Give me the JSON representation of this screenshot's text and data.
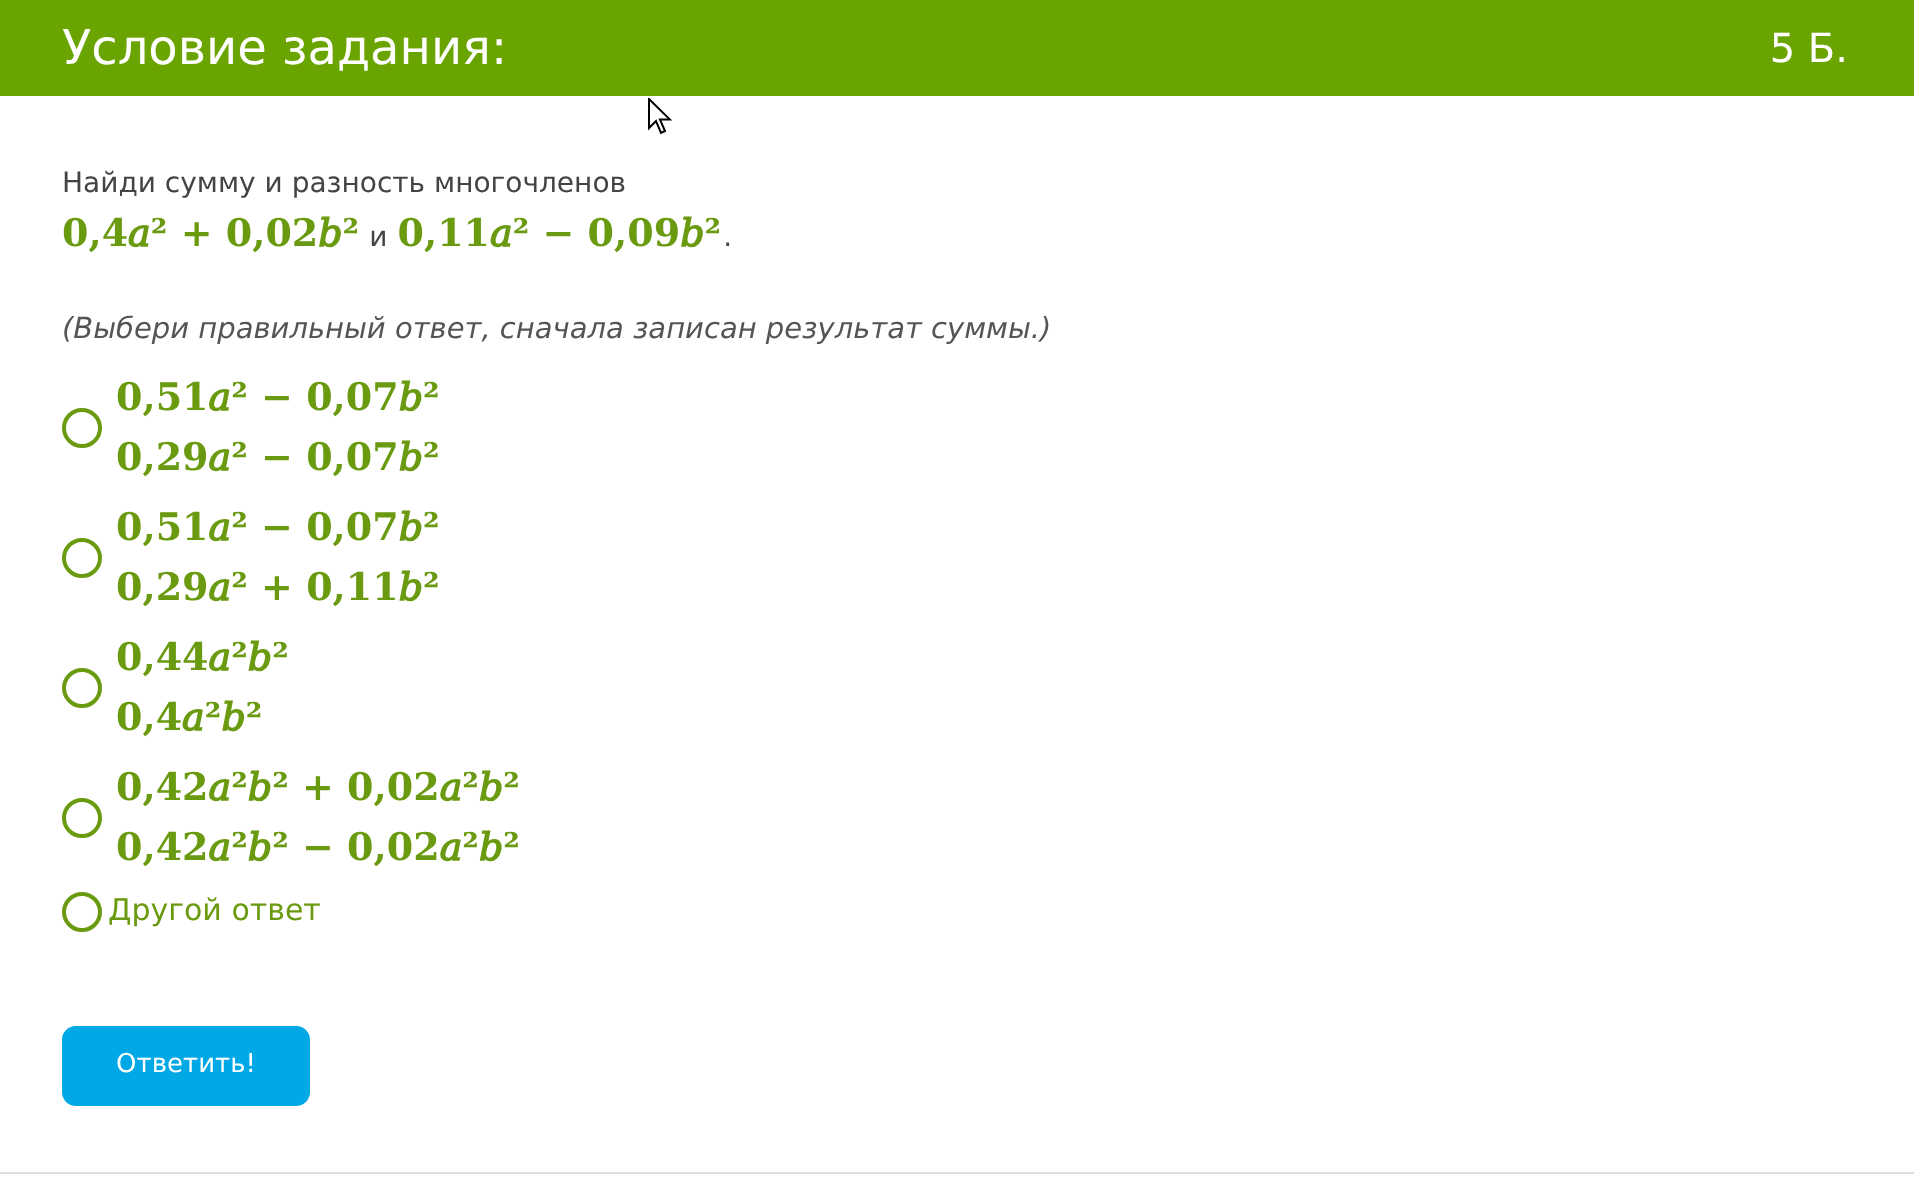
{
  "header": {
    "title": "Условие задания:",
    "points": "5 Б."
  },
  "question": {
    "text": "Найди сумму и разность многочленов",
    "formula_1": "0,4𝑎² + 0,02𝑏²",
    "conjunction": "и",
    "formula_2": "0,11𝑎² − 0,09𝑏²",
    "ending": "."
  },
  "hint": "(Выбери правильный ответ, сначала записан результат суммы.)",
  "options": [
    {
      "kind": "formula",
      "selected": false,
      "lines": [
        "0,51𝑎² − 0,07𝑏²",
        "0,29𝑎² − 0,07𝑏²"
      ]
    },
    {
      "kind": "formula",
      "selected": false,
      "lines": [
        "0,51𝑎² − 0,07𝑏²",
        "0,29𝑎² + 0,11𝑏²"
      ]
    },
    {
      "kind": "formula",
      "selected": false,
      "lines": [
        "0,44𝑎²𝑏²",
        "0,4𝑎²𝑏²"
      ]
    },
    {
      "kind": "formula",
      "selected": false,
      "lines": [
        "0,42𝑎²𝑏² + 0,02𝑎²𝑏²",
        "0,42𝑎²𝑏² − 0,02𝑎²𝑏²"
      ]
    },
    {
      "kind": "text",
      "selected": false,
      "label": "Другой ответ"
    }
  ],
  "submit": "Ответить!"
}
